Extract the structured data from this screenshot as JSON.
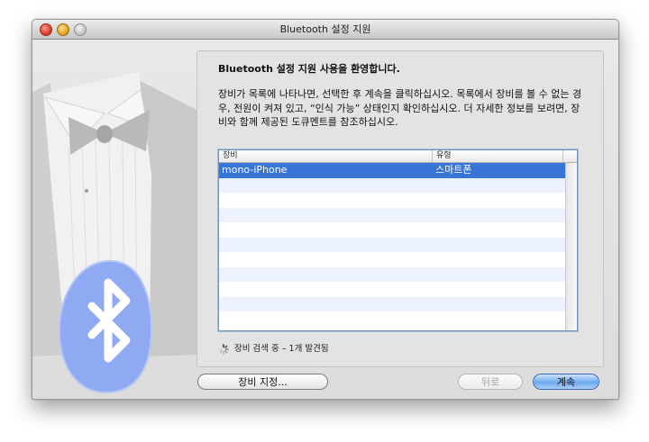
{
  "window": {
    "title": "Bluetooth 설정 지원"
  },
  "main": {
    "welcome": "Bluetooth 설정 지원 사용을 환영합니다.",
    "instructions": "장비가 목록에 나타나면, 선택한 후 계속을 클릭하십시오. 목록에서 장비를 볼 수 없는 경우, 전원이 켜져 있고, “인식 가능” 상태인지 확인하십시오. 더 자세한 정보를 보려면, 장비와 함께 제공된 도큐멘트를 참조하십시오."
  },
  "devices": {
    "columns": [
      "장비",
      "유형"
    ],
    "rows": [
      {
        "name": "mono-iPhone",
        "type": "스마트폰",
        "selected": true
      }
    ]
  },
  "status": {
    "text": "장비 검색 중 – 1개 발견됨"
  },
  "buttons": {
    "pair": "장비 지정...",
    "back": "뒤로",
    "continue": "계속"
  },
  "colors": {
    "selection": "#3875d7",
    "default_button": "#6ea9ee",
    "bluetooth_badge": "#8fa9f2"
  },
  "icons": {
    "illustration": "tuxedo-illustration",
    "bluetooth": "bluetooth-icon",
    "spinner": "spinner-icon"
  }
}
